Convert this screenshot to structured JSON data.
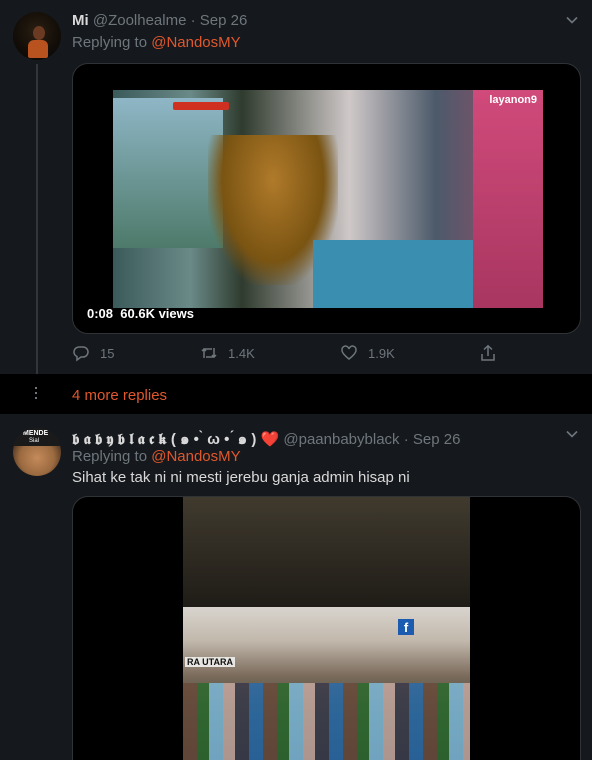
{
  "tweet1": {
    "name": "Mi",
    "handle": "@Zoolhealme",
    "separator": "·",
    "date": "Sep 26",
    "replying_prefix": "Replying to ",
    "replying_to": "@NandosMY",
    "video": {
      "channel_logo": "layanon9",
      "duration": "0:08",
      "views": "60.6K views"
    },
    "actions": {
      "replies": "15",
      "retweets": "1.4K",
      "likes": "1.9K"
    }
  },
  "more_replies": "4 more replies",
  "tweet2": {
    "avatar_text_top": "MENDE",
    "avatar_text_bottom": "Sial",
    "name": "𝖇 𝖆 𝖇 𝖞 𝖇 𝖑 𝖆 𝖈 𝖐 ( ๑ • ̀ ω • ́ ๑ ) ",
    "heart": "❤️",
    "handle": "@paanbabyblack",
    "separator": "·",
    "date": "Sep 26",
    "replying_prefix": "Replying to ",
    "replying_to": "@NandosMY",
    "text": "Sihat ke tak ni  ni mesti jerebu ganja admin hisap ni",
    "video": {
      "overlay_text": "RA UTARA",
      "fb_icon": "f"
    }
  },
  "colors": {
    "background": "#15181c",
    "divider": "#000000",
    "accent": "#e0582d",
    "muted": "#6e767d",
    "text": "#d9d9d9",
    "heart": "#e0245e"
  },
  "icons": [
    "chevron-down-icon",
    "reply-icon",
    "retweet-icon",
    "like-icon",
    "share-icon",
    "more-dots-icon"
  ]
}
